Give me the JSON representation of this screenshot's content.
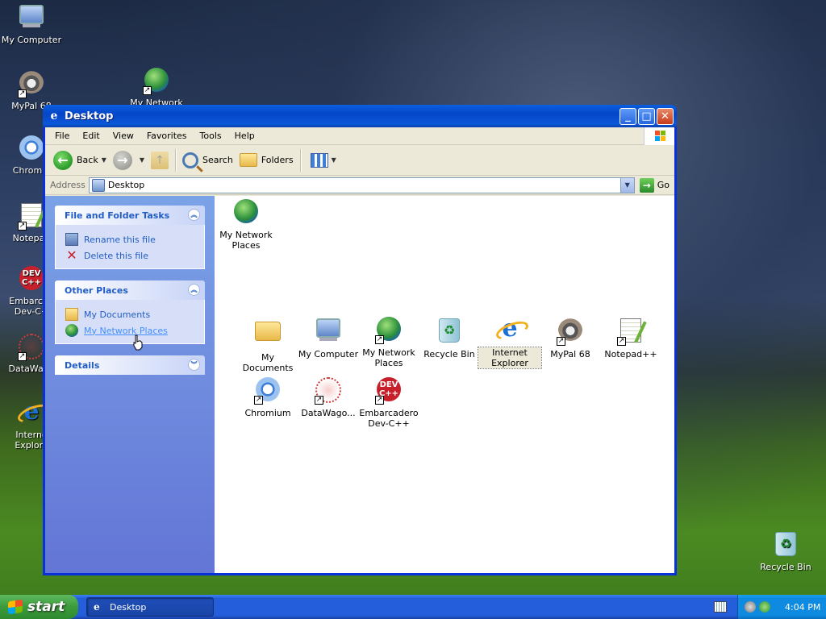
{
  "desktop": {
    "icons": [
      {
        "label": "My Computer"
      },
      {
        "label": "MyPal 68"
      },
      {
        "label": "My Network"
      },
      {
        "label": "Chromiu"
      },
      {
        "label": "Notepad"
      },
      {
        "label": "Embarcad"
      },
      {
        "label": "Dev-C+"
      },
      {
        "label": "DataWago"
      },
      {
        "label": "Interne"
      },
      {
        "label": "Explore"
      },
      {
        "label": "Recycle Bin"
      }
    ],
    "dev_badge": [
      "DEV",
      "C++"
    ]
  },
  "window": {
    "title": "Desktop",
    "menu": [
      "File",
      "Edit",
      "View",
      "Favorites",
      "Tools",
      "Help"
    ],
    "toolbar": {
      "back": "Back",
      "search": "Search",
      "folders": "Folders"
    },
    "address": {
      "label": "Address",
      "value": "Desktop",
      "go": "Go"
    },
    "tasks": {
      "file_folder": {
        "title": "File and Folder Tasks",
        "items": [
          "Rename this file",
          "Delete this file"
        ]
      },
      "other_places": {
        "title": "Other Places",
        "items": [
          "My Documents",
          "My Network Places"
        ]
      },
      "details": {
        "title": "Details"
      }
    },
    "files": [
      {
        "label": "My Network Places"
      },
      {
        "label": "My Documents"
      },
      {
        "label": "My Computer"
      },
      {
        "label": "My Network Places"
      },
      {
        "label": "Recycle Bin"
      },
      {
        "label": "Internet Explorer"
      },
      {
        "label": "MyPal 68"
      },
      {
        "label": "Notepad++"
      },
      {
        "label": "Chromium"
      },
      {
        "label": "DataWago..."
      },
      {
        "label": "Embarcadero Dev-C++"
      }
    ]
  },
  "taskbar": {
    "start": "start",
    "task_button": "Desktop",
    "clock": "4:04 PM"
  },
  "colors": {
    "title_blue": "#0a57d8",
    "taskpane_link": "#215dc6",
    "start_green": "#3c9a3c"
  }
}
